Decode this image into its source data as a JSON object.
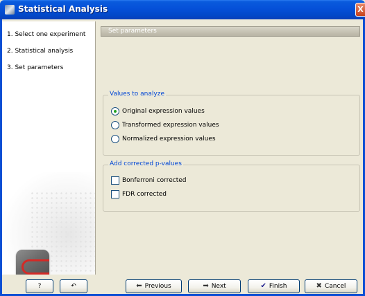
{
  "window": {
    "title": "Statistical Analysis",
    "close_glyph": "X"
  },
  "steps": [
    {
      "label": "1.  Select one experiment"
    },
    {
      "label": "2.  Statistical analysis"
    },
    {
      "label": "3.  Set parameters"
    }
  ],
  "section": {
    "title": "Set parameters"
  },
  "values_group": {
    "title": "Values to analyze",
    "options": [
      {
        "label": "Original expression values",
        "checked": true
      },
      {
        "label": "Transformed expression values",
        "checked": false
      },
      {
        "label": "Normalized expression values",
        "checked": false
      }
    ]
  },
  "pvalues_group": {
    "title": "Add corrected p-values",
    "options": [
      {
        "label": "Bonferroni corrected",
        "checked": false
      },
      {
        "label": "FDR corrected",
        "checked": false
      }
    ]
  },
  "buttons": {
    "help": "?",
    "reset_icon": "undo-icon",
    "previous": "Previous",
    "next": "Next",
    "finish": "Finish",
    "cancel": "Cancel"
  },
  "colors": {
    "titlebar": "#0550d8",
    "groupbox_title": "#0046d5",
    "dialog_bg": "#ece9d8"
  }
}
